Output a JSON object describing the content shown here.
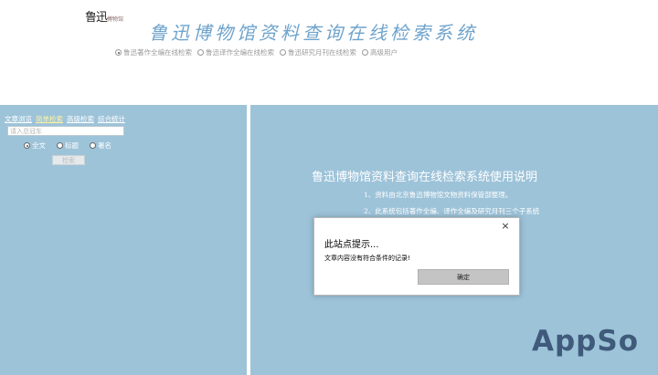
{
  "header": {
    "logo_text": "鲁迅",
    "logo_subtext": "博物馆",
    "site_title": "鲁迅博物馆资料查询在线检索系统",
    "db_options": [
      {
        "label": "鲁迅著作全编在线检索",
        "checked": true
      },
      {
        "label": "鲁迅译作全编在线检索",
        "checked": false
      },
      {
        "label": "鲁迅研究月刊在线检索",
        "checked": false
      },
      {
        "label": "高级用户",
        "checked": false
      }
    ]
  },
  "sidebar": {
    "tabs": [
      {
        "label": "文章浏览",
        "active": false
      },
      {
        "label": "简单检索",
        "active": true
      },
      {
        "label": "高级检索",
        "active": false
      },
      {
        "label": "综合统计",
        "active": false
      }
    ],
    "search_placeholder": "请入总冠车",
    "field_options": [
      {
        "label": "全文",
        "checked": true
      },
      {
        "label": "标题",
        "checked": false
      },
      {
        "label": "署名",
        "checked": false
      }
    ],
    "search_button": "检索"
  },
  "main": {
    "help_title": "鲁迅博物馆资料查询在线检索系统使用说明",
    "help_items": [
      "1、资料由北京鲁迅博物馆文物资料保管部整理。",
      "2、此系统包括著作全编、译作全编及研究月刊三个子系统"
    ]
  },
  "dialog": {
    "close_glyph": "×",
    "title": "此站点提示...",
    "message": "文章内容没有符合条件的记录!",
    "ok_label": "确定"
  },
  "watermark": "AppSo",
  "colors": {
    "panel_bg": "#9dc3d9",
    "title_blue": "#6ea3cc",
    "active_tab": "#fff3a0"
  }
}
